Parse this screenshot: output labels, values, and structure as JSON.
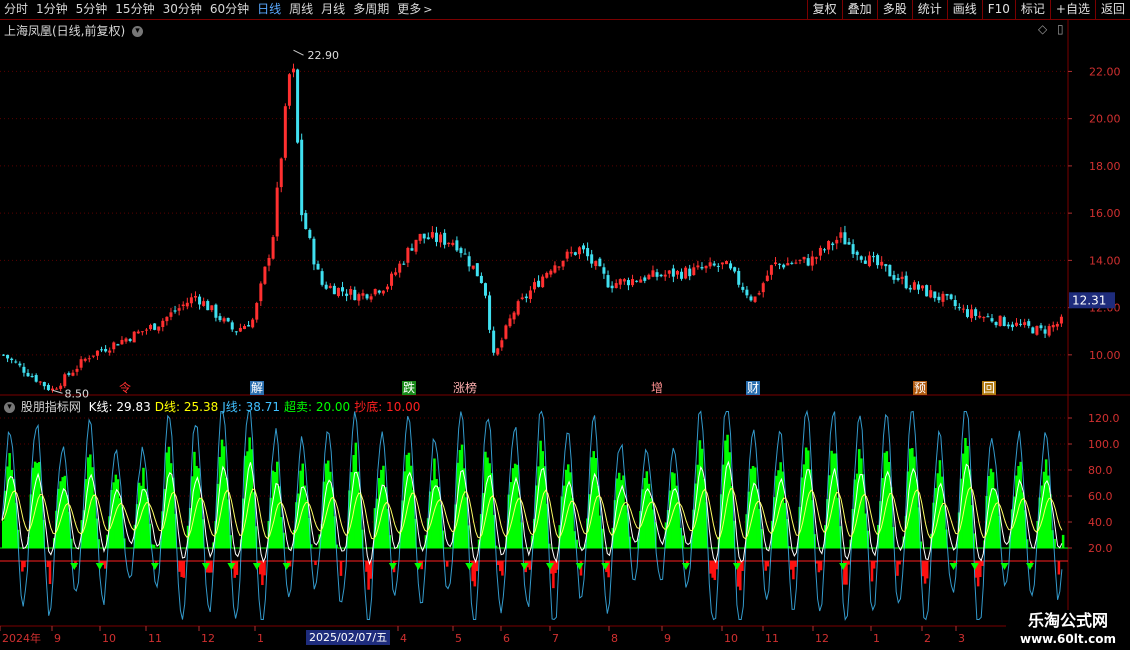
{
  "toolbar": {
    "timeframes": [
      {
        "label": "分时",
        "active": false
      },
      {
        "label": "1分钟",
        "active": false
      },
      {
        "label": "5分钟",
        "active": false
      },
      {
        "label": "15分钟",
        "active": false
      },
      {
        "label": "30分钟",
        "active": false
      },
      {
        "label": "60分钟",
        "active": false
      },
      {
        "label": "日线",
        "active": true
      },
      {
        "label": "周线",
        "active": false
      },
      {
        "label": "月线",
        "active": false
      },
      {
        "label": "多周期",
        "active": false
      },
      {
        "label": "更多",
        "active": false
      }
    ],
    "right_buttons": [
      "复权",
      "叠加",
      "多股",
      "统计",
      "画线",
      "F10",
      "标记",
      "+自选",
      "返回"
    ]
  },
  "main_chart": {
    "title": "上海凤凰(日线,前复权)",
    "current_price": "12.31",
    "max_label": "22.90",
    "min_label": "8.50",
    "markers": [
      "令",
      "解",
      "跌",
      "涨榜",
      "增",
      "财",
      "预",
      "回"
    ],
    "colors": {
      "up": "#ff3030",
      "down": "#40e0f0",
      "panel_border": "#7a0000"
    }
  },
  "indicator": {
    "name": "股朋指标网",
    "legend": [
      {
        "key": "K线:",
        "value": "29.83",
        "color": "#ffffff"
      },
      {
        "key": "D线:",
        "value": "25.38",
        "color": "#ffff00"
      },
      {
        "key": "J线:",
        "value": "38.71",
        "color": "#40c0ff"
      },
      {
        "key": "超卖:",
        "value": "20.00",
        "color": "#00ff00"
      },
      {
        "key": "抄底:",
        "value": "10.00",
        "color": "#ff2020"
      }
    ]
  },
  "x_axis": {
    "labels": [
      "2024年",
      "9",
      "10",
      "11",
      "12",
      "1",
      "4",
      "5",
      "6",
      "7",
      "8",
      "9",
      "10",
      "11",
      "12",
      "1",
      "2",
      "3"
    ],
    "selected_date": "2025/02/07/五"
  },
  "watermark": {
    "line1": "乐淘公式网",
    "line2": "www.60lt.com"
  },
  "chart_data": [
    {
      "type": "candlestick",
      "title": "上海凤凰(日线,前复权)",
      "ylim": [
        8.3,
        23.5
      ],
      "y_ticks": [
        10,
        12,
        14,
        16,
        18,
        20,
        22
      ],
      "anchor_points": [
        {
          "t": 0.0,
          "price": 10.0
        },
        {
          "t": 0.05,
          "price": 8.5
        },
        {
          "t": 0.09,
          "price": 10.0
        },
        {
          "t": 0.16,
          "price": 11.3
        },
        {
          "t": 0.2,
          "price": 12.5
        },
        {
          "t": 0.24,
          "price": 11.0
        },
        {
          "t": 0.26,
          "price": 11.5
        },
        {
          "t": 0.28,
          "price": 15.0
        },
        {
          "t": 0.3,
          "price": 22.9
        },
        {
          "t": 0.31,
          "price": 16.0
        },
        {
          "t": 0.33,
          "price": 13.0
        },
        {
          "t": 0.37,
          "price": 12.5
        },
        {
          "t": 0.4,
          "price": 13.0
        },
        {
          "t": 0.43,
          "price": 15.0
        },
        {
          "t": 0.47,
          "price": 14.8
        },
        {
          "t": 0.5,
          "price": 13.0
        },
        {
          "t": 0.51,
          "price": 9.8
        },
        {
          "t": 0.53,
          "price": 11.8
        },
        {
          "t": 0.57,
          "price": 13.8
        },
        {
          "t": 0.6,
          "price": 14.5
        },
        {
          "t": 0.63,
          "price": 13.0
        },
        {
          "t": 0.67,
          "price": 13.3
        },
        {
          "t": 0.71,
          "price": 13.5
        },
        {
          "t": 0.75,
          "price": 13.8
        },
        {
          "t": 0.78,
          "price": 12.3
        },
        {
          "t": 0.8,
          "price": 13.8
        },
        {
          "t": 0.84,
          "price": 14.0
        },
        {
          "t": 0.87,
          "price": 15.0
        },
        {
          "t": 0.9,
          "price": 14.0
        },
        {
          "t": 0.94,
          "price": 13.0
        },
        {
          "t": 0.98,
          "price": 12.3
        },
        {
          "t": 1.0,
          "price": 11.8
        },
        {
          "t": 1.04,
          "price": 11.4
        },
        {
          "t": 1.08,
          "price": 11.0
        },
        {
          "t": 1.1,
          "price": 11.4
        }
      ]
    },
    {
      "type": "area",
      "title": "股朋指标网",
      "ylim": [
        -40,
        130
      ],
      "y_ticks": [
        20,
        40,
        60,
        80,
        100,
        120
      ],
      "series": [
        {
          "name": "K线",
          "value": 29.83
        },
        {
          "name": "D线",
          "value": 25.38
        },
        {
          "name": "J线",
          "value": 38.71
        },
        {
          "name": "超卖",
          "value": 20.0
        },
        {
          "name": "抄底",
          "value": 10.0
        }
      ],
      "oscillation_cycles": 40
    }
  ]
}
